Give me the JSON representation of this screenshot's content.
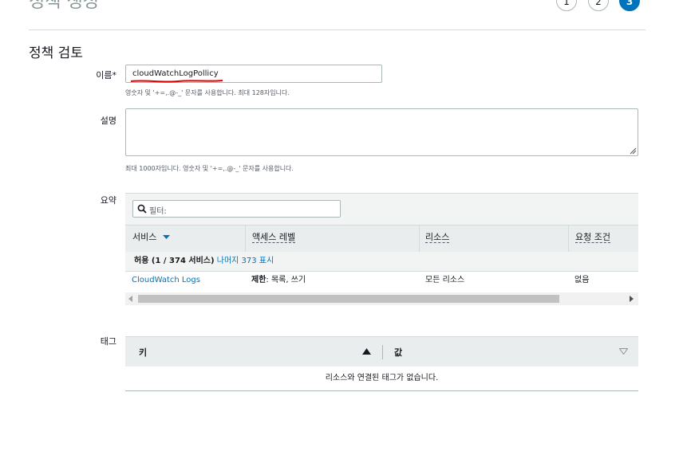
{
  "wizard": {
    "page_title": "정책 생성",
    "steps": [
      "1",
      "2",
      "3"
    ],
    "active_step": "3"
  },
  "review": {
    "section_title": "정책 검토",
    "name": {
      "label": "이름*",
      "value": "cloudWatchLogPollicy",
      "hint": "영숫자 및 '+=,.@-_' 문자를 사용합니다. 최대 128자입니다."
    },
    "description": {
      "label": "설명",
      "value": "",
      "hint": "최대 1000자입니다. 영숫자 및 '+=,.@-_' 문자를 사용합니다."
    }
  },
  "summary": {
    "label": "요약",
    "filter_placeholder": "필터:",
    "columns": [
      "서비스",
      "액세스 레벨",
      "리소스",
      "요청 조건"
    ],
    "group": {
      "text": "허용 (1 / 374 서비스)",
      "link": "나머지 373 표시"
    },
    "rows": [
      {
        "service": "CloudWatch Logs",
        "access_bold": "제한",
        "access_rest": ": 목록, 쓰기",
        "resource": "모든 리소스",
        "condition": "없음"
      }
    ]
  },
  "tags": {
    "label": "태그",
    "columns": [
      "키",
      "값"
    ],
    "empty_text": "리소스와 연결된 태그가 없습니다."
  },
  "colors": {
    "accent": "#0073bb",
    "underline_annotation": "#e00000"
  },
  "icons": [
    "search-icon",
    "sort-down-icon",
    "sort-up-icon",
    "sort-icon",
    "scroll-left-icon",
    "scroll-right-icon",
    "resize-handle-icon"
  ]
}
